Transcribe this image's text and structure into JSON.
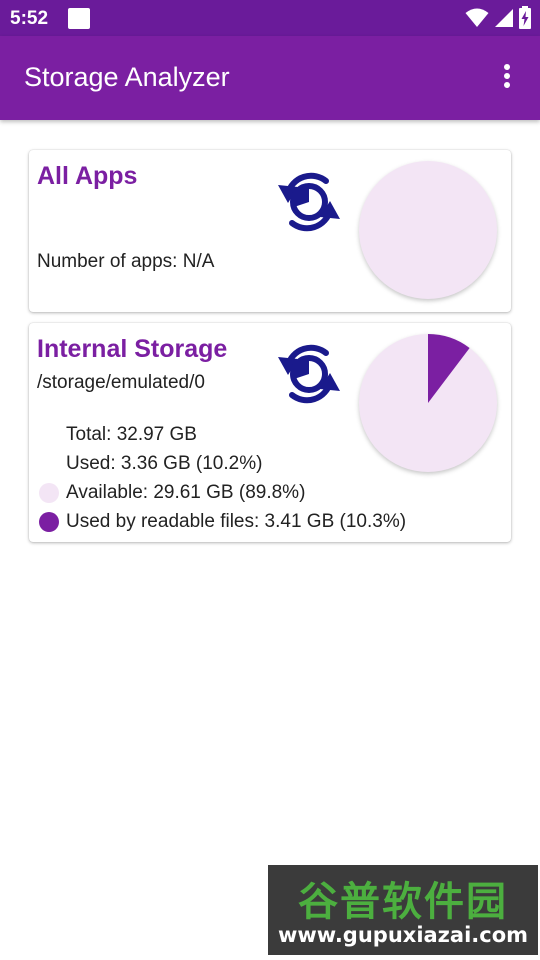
{
  "status_bar": {
    "time": "5:52",
    "icons": [
      "wifi-icon",
      "cell-signal-icon",
      "battery-charging-icon"
    ]
  },
  "app_bar": {
    "title": "Storage Analyzer",
    "menu_icon": "more-vert-icon"
  },
  "all_apps_card": {
    "title": "All Apps",
    "count_label": "Number of apps: ",
    "count_value": "N/A",
    "refresh_icon": "refresh-icon",
    "pie_used_fraction": 0
  },
  "storage_card": {
    "title": "Internal Storage",
    "path": "/storage/emulated/0",
    "refresh_icon": "refresh-icon",
    "pie_used_fraction": 0.103,
    "total": "Total: 32.97 GB",
    "used": "Used: 3.36 GB (10.2%)",
    "available": "Available: 29.61 GB (89.8%)",
    "used_by_files": "Used by readable files: 3.41 GB (10.3%)"
  },
  "colors": {
    "status_bar": "#6a1b9a",
    "app_bar": "#7b1fa2",
    "accent": "#7b1fa2",
    "pie_background": "#f3e5f5",
    "refresh_icon": "#1a1a8c"
  },
  "watermark": {
    "top": "谷普软件园",
    "bottom": "www.gupuxiazai.com"
  }
}
